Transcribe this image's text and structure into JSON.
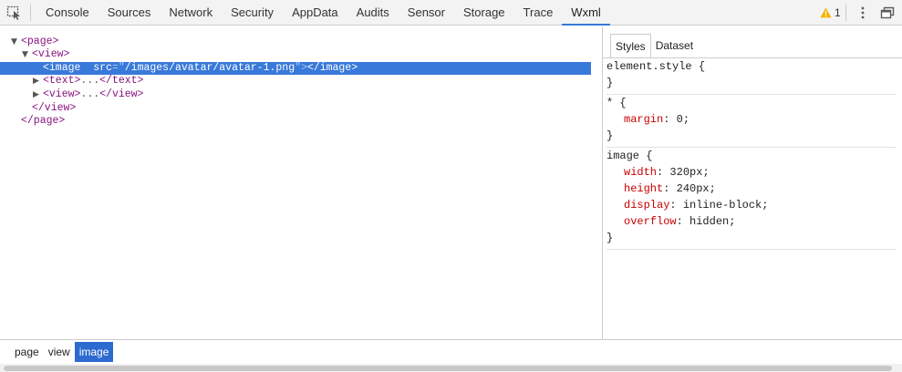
{
  "toolbar": {
    "tabs": [
      "Console",
      "Sources",
      "Network",
      "Security",
      "AppData",
      "Audits",
      "Sensor",
      "Storage",
      "Trace",
      "Wxml"
    ],
    "active_tab": "Wxml",
    "warning_count": "1",
    "accent_color": "#3879d9",
    "warning_color": "#f4b400"
  },
  "tree": {
    "rows": [
      {
        "indent": 0,
        "toggle": "expanded",
        "open": "<page>"
      },
      {
        "indent": 1,
        "toggle": "expanded",
        "open": "<view>"
      },
      {
        "indent": 2,
        "toggle": "none",
        "selected": true,
        "tag": "image",
        "attr_name": "src",
        "attr_value": "/images/avatar/avatar-1.png",
        "close": "</image>"
      },
      {
        "indent": 2,
        "toggle": "collapsed",
        "open": "<text>",
        "dots": "...",
        "close": "</text>"
      },
      {
        "indent": 2,
        "toggle": "collapsed",
        "open": "<view>",
        "dots": "...",
        "close": "</view>"
      },
      {
        "indent": 1,
        "toggle": "none",
        "open": "</view>"
      },
      {
        "indent": 0,
        "toggle": "none",
        "open": "</page>"
      }
    ]
  },
  "pane": {
    "tabs": [
      "Styles",
      "Dataset"
    ],
    "active_tab": "Styles",
    "rules": [
      {
        "selector": "element.style {",
        "declarations": [],
        "close": "}"
      },
      {
        "selector": "* {",
        "declarations": [
          {
            "prop": "margin",
            "value": "0"
          }
        ],
        "close": "}"
      },
      {
        "selector": "image {",
        "declarations": [
          {
            "prop": "width",
            "value": "320px"
          },
          {
            "prop": "height",
            "value": "240px"
          },
          {
            "prop": "display",
            "value": "inline-block"
          },
          {
            "prop": "overflow",
            "value": "hidden"
          }
        ],
        "close": "}"
      }
    ]
  },
  "breadcrumb": {
    "items": [
      "page",
      "view",
      "image"
    ],
    "active": "image"
  }
}
